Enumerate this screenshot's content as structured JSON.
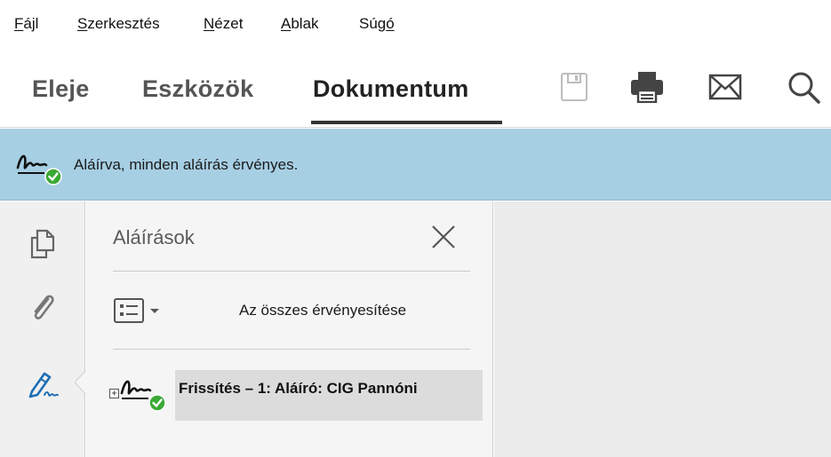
{
  "menu": {
    "items": [
      {
        "label": "Fájl",
        "mnemonic": "F",
        "rest": "ájl"
      },
      {
        "label": "Szerkesztés",
        "mnemonic": "S",
        "rest": "zerkesztés"
      },
      {
        "label": "Nézet",
        "mnemonic": "N",
        "rest": "ézet"
      },
      {
        "label": "Ablak",
        "mnemonic": "A",
        "rest": "blak"
      },
      {
        "label": "Súgó",
        "mnemonic": "ó",
        "pre": "Súg"
      }
    ]
  },
  "toolbar": {
    "tabs": [
      {
        "label": "Eleje",
        "active": false
      },
      {
        "label": "Eszközök",
        "active": false
      },
      {
        "label": "Dokumentum",
        "active": true
      }
    ],
    "tools": [
      "save-icon",
      "print-icon",
      "mail-icon",
      "search-icon"
    ]
  },
  "status": {
    "text": "Aláírva, minden aláírás érvényes.",
    "icon": "signature-valid-icon"
  },
  "leftnav": {
    "items": [
      "pages-icon",
      "attachment-icon",
      "signature-pen-icon"
    ]
  },
  "panel": {
    "title": "Aláírások",
    "validate_all": "Az összes érvényesítése",
    "signatures": [
      {
        "label": "Frissítés – 1: Aláíró: CIG Pannóni",
        "expand": "+"
      }
    ]
  },
  "colors": {
    "status_bg": "#a7cfe4",
    "valid_green": "#3aa935",
    "signature_blue": "#1f6fb5"
  }
}
